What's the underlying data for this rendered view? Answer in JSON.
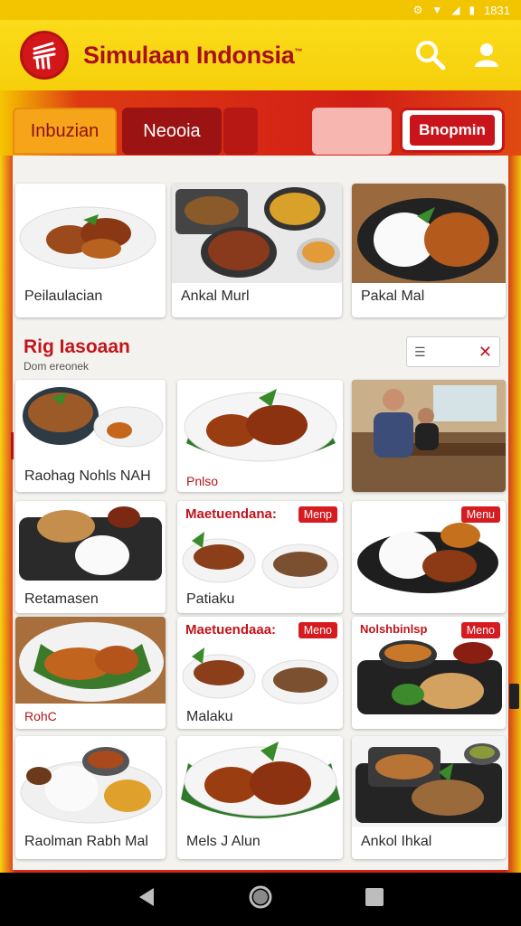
{
  "status": {
    "time": "1831"
  },
  "app": {
    "title": "Simulaan Indonsia",
    "title_mark": "™"
  },
  "tabs": [
    {
      "label": "Inbuzian"
    },
    {
      "label": "Neooia"
    },
    {
      "label": ""
    },
    {
      "label": ""
    },
    {
      "label": "Bnopmin"
    }
  ],
  "featured": [
    {
      "label": "Peilaulacian",
      "photo": "fried-chicken-plate"
    },
    {
      "label": "Ankal Murl",
      "photo": "curry-bowls-tray"
    },
    {
      "label": "Pakal Mal",
      "photo": "rice-chicken-black-plate"
    }
  ],
  "section": {
    "title": "Rig Iasoaan",
    "subtitle": "Dom ereonek"
  },
  "grid": [
    {
      "label": "Raohag Nohls NAH",
      "photo": "noodle-bowl-sambal",
      "heading": "",
      "badge": ""
    },
    {
      "label": "Pnlso",
      "photo": "grilled-chicken-leaves",
      "heading": "",
      "badge": "",
      "red": true
    },
    {
      "label": "",
      "photo": "restaurant-diners",
      "heading": "",
      "badge": ""
    },
    {
      "label": "Retamasen",
      "photo": "rice-fritter-tray",
      "heading": "",
      "badge": ""
    },
    {
      "label": "Patiaku",
      "photo": "satay-bowls",
      "heading": "Maetuendana:",
      "badge": "Menp"
    },
    {
      "label": "",
      "photo": "rice-chicken-skillet",
      "heading": "",
      "badge": "Menu"
    },
    {
      "label": "RohC",
      "photo": "fried-chicken-banana-leaf",
      "heading": "",
      "badge": "",
      "red": true
    },
    {
      "label": "Malaku",
      "photo": "satay-bowls",
      "heading": "Maetuendaaa:",
      "badge": "Meno"
    },
    {
      "label": "",
      "photo": "fritter-bowls-tray",
      "heading": "Nolshbinlsp",
      "badge": "Meno"
    },
    {
      "label": "Raolman Rabh Mal",
      "photo": "rice-sides-plates",
      "heading": "",
      "badge": ""
    },
    {
      "label": "Mels J Alun",
      "photo": "grilled-chicken-leaves",
      "heading": "",
      "badge": ""
    },
    {
      "label": "Ankol Ihkal",
      "photo": "mixed-platter-tray",
      "heading": "",
      "badge": ""
    }
  ],
  "colors": {
    "brand_red": "#d2161a",
    "brand_yellow": "#f6cf0b"
  }
}
